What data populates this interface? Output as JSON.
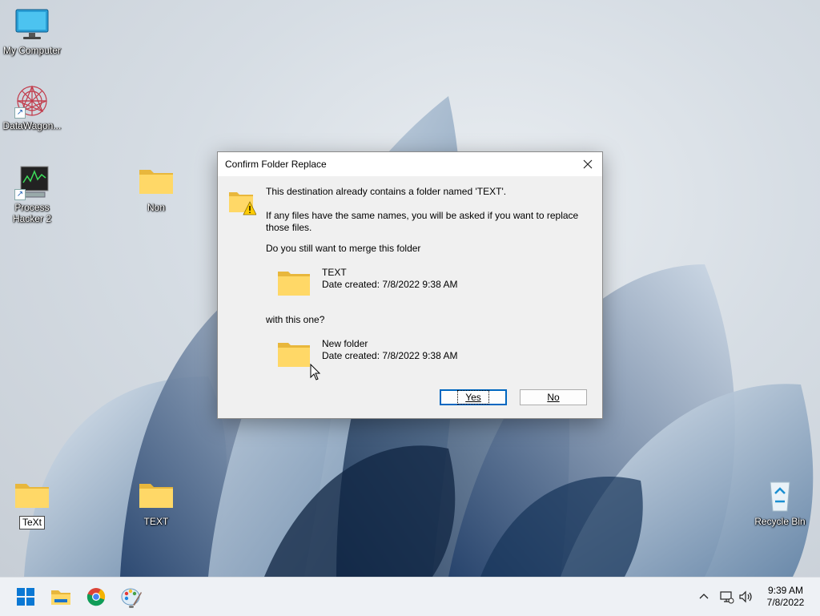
{
  "desktop": {
    "icons": [
      {
        "label": "My Computer",
        "icon": "monitor-icon"
      },
      {
        "label": "DataWagon...",
        "icon": "datawagon-icon"
      },
      {
        "label": "Process Hacker 2",
        "icon": "process-hacker-icon"
      },
      {
        "label": "Non",
        "icon": "folder-icon"
      },
      {
        "label": "TeXt",
        "icon": "folder-icon"
      },
      {
        "label": "TEXT",
        "icon": "folder-icon"
      },
      {
        "label": "Recycle Bin",
        "icon": "recycle-bin-icon"
      }
    ]
  },
  "dialog": {
    "title": "Confirm Folder Replace",
    "close_icon": "close-icon",
    "message": "This destination already contains a folder named 'TEXT'.",
    "detail_line1": "If any files have the same names, you will be asked if you want to replace",
    "detail_line2": "those files.",
    "question": "Do you still want to merge this folder",
    "source": {
      "name": "TEXT",
      "date": "Date created: 7/8/2022 9:38 AM"
    },
    "with_text": "with this one?",
    "target": {
      "name": "New folder",
      "date": "Date created: 7/8/2022 9:38 AM"
    },
    "yes_label": "Yes",
    "no_label": "No"
  },
  "taskbar": {
    "apps": [
      "start-icon",
      "file-explorer-icon",
      "chrome-icon",
      "paint-icon"
    ],
    "tray": [
      "chevron-up-icon",
      "network-icon",
      "volume-icon"
    ],
    "time": "9:39 AM",
    "date": "7/8/2022"
  }
}
